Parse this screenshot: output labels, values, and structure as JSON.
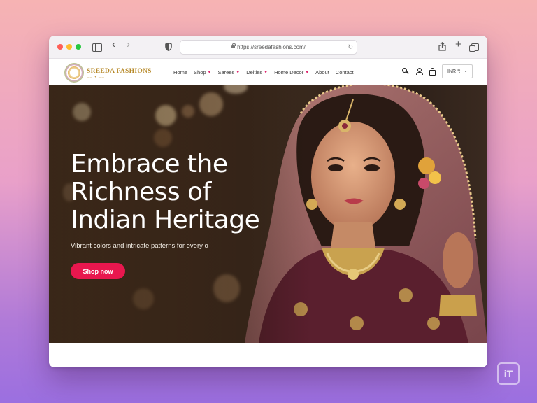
{
  "browser": {
    "url": "https://sreedafashions.com/"
  },
  "site": {
    "logo_name": "SREEDA FASHIONS",
    "nav": [
      {
        "label": "Home",
        "dropdown": false
      },
      {
        "label": "Shop",
        "dropdown": true
      },
      {
        "label": "Sarees",
        "dropdown": true
      },
      {
        "label": "Deities",
        "dropdown": true
      },
      {
        "label": "Home Decor",
        "dropdown": true
      },
      {
        "label": "About",
        "dropdown": false
      },
      {
        "label": "Contact",
        "dropdown": false
      }
    ],
    "currency": "INR ₹"
  },
  "hero": {
    "title_line1": "Embrace the",
    "title_line2": "Richness of",
    "title_line3": "Indian Heritage",
    "subtitle": "Vibrant colors and intricate patterns for every o",
    "cta_label": "Shop now"
  },
  "colors": {
    "accent": "#e8174e",
    "nav_chevron": "#e0246c",
    "logo_gold": "#b78a2a"
  },
  "watermark": "iT"
}
